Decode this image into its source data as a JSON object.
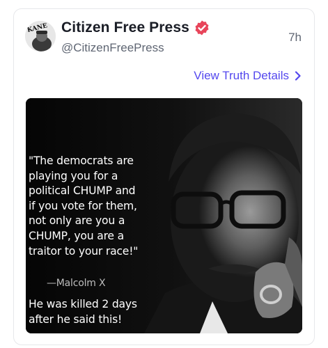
{
  "post": {
    "author": {
      "display_name": "Citizen Free Press",
      "handle": "@CitizenFreePress",
      "verified": true,
      "avatar_text": "KANE"
    },
    "timestamp": "7h",
    "details_link": "View Truth Details",
    "media": {
      "quote_lines": [
        "\"The democrats are",
        "playing you for a",
        "political CHUMP and",
        "if you vote for them,",
        "not only are you a",
        "CHUMP, you are a",
        "traitor to your race!\""
      ],
      "attribution": "—Malcolm X",
      "caption_lines": [
        "He was killed 2 days",
        "after he said this!"
      ]
    }
  },
  "colors": {
    "accent": "#5448ee",
    "verified_badge": "#e8455a",
    "text_primary": "#1a1d26",
    "text_secondary": "#5f6673",
    "card_border": "#e6e7ea"
  },
  "icons": {
    "verified": "verified-badge-icon",
    "chevron": "chevron-right-icon"
  }
}
